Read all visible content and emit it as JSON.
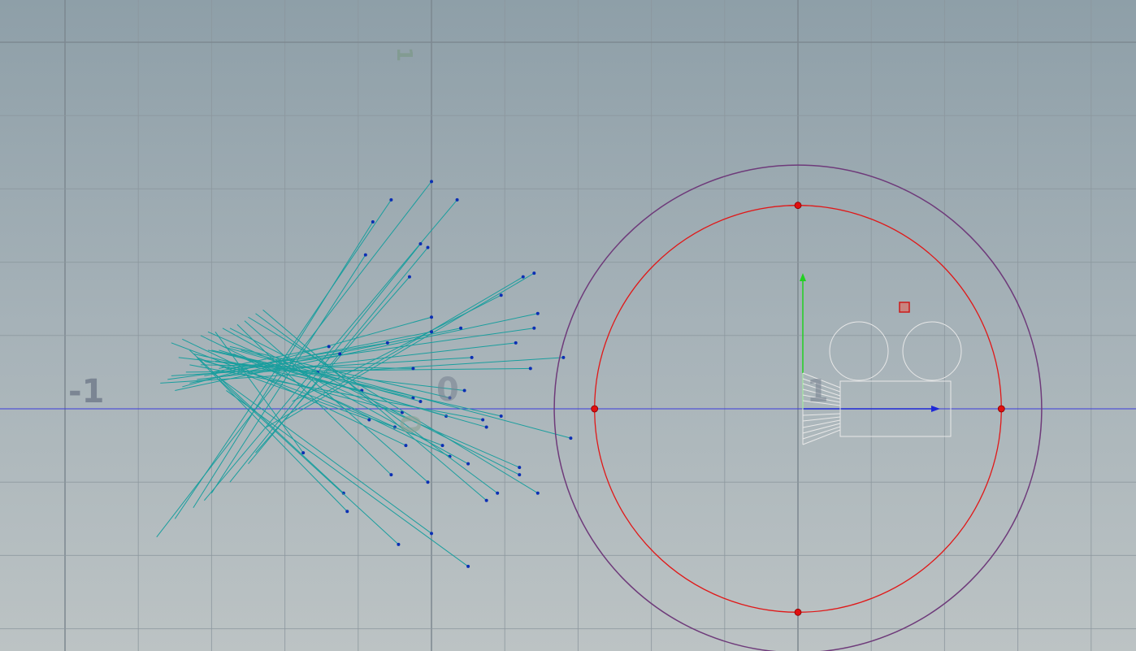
{
  "viewport": {
    "axis_labels": {
      "x_negative": "-1",
      "x_origin": "0",
      "x_positive": "1",
      "y_positive": "1",
      "y_origin": "0"
    },
    "colors": {
      "background_top": "#8e9fa8",
      "background_bottom": "#bcc3c4",
      "grid_minor": "#8c979e",
      "grid_major": "#7d8890",
      "x_axis": "#3b3bdc",
      "y_axis_gizmo": "#22d022",
      "x_gizmo": "#1e28d8",
      "stream_line": "#1a9e9e",
      "stream_point": "#0b2fb4",
      "inner_circle": "#e01818",
      "outer_circle": "#6e3a7a",
      "handle": "#e01010",
      "camera_wireframe": "#e8e8e8"
    },
    "icons": [
      "camera-icon",
      "pivot-handle-icon"
    ]
  },
  "scene": {
    "stream_lines": [
      {
        "from": [
          -0.75,
          -0.35
        ],
        "to": [
          0.0,
          0.62
        ]
      },
      {
        "from": [
          -0.7,
          -0.3
        ],
        "to": [
          -0.11,
          0.57
        ]
      },
      {
        "from": [
          -0.62,
          -0.25
        ],
        "to": [
          0.07,
          0.57
        ]
      },
      {
        "from": [
          -0.65,
          -0.27
        ],
        "to": [
          -0.16,
          0.51
        ]
      },
      {
        "from": [
          -0.55,
          -0.2
        ],
        "to": [
          -0.03,
          0.45
        ]
      },
      {
        "from": [
          -0.6,
          -0.23
        ],
        "to": [
          -0.18,
          0.42
        ]
      },
      {
        "from": [
          -0.5,
          -0.15
        ],
        "to": [
          -0.01,
          0.44
        ]
      },
      {
        "from": [
          -0.48,
          -0.12
        ],
        "to": [
          -0.06,
          0.36
        ]
      },
      {
        "from": [
          -0.45,
          -0.05
        ],
        "to": [
          0.25,
          0.36
        ]
      },
      {
        "from": [
          -0.4,
          -0.03
        ],
        "to": [
          0.28,
          0.37
        ]
      },
      {
        "from": [
          -0.38,
          0.02
        ],
        "to": [
          0.19,
          0.31
        ]
      },
      {
        "from": [
          -0.7,
          0.05
        ],
        "to": [
          0.29,
          0.26
        ]
      },
      {
        "from": [
          -0.72,
          0.08
        ],
        "to": [
          0.28,
          0.22
        ]
      },
      {
        "from": [
          -0.68,
          0.06
        ],
        "to": [
          0.0,
          0.25
        ]
      },
      {
        "from": [
          -0.66,
          0.07
        ],
        "to": [
          0.08,
          0.22
        ]
      },
      {
        "from": [
          -0.64,
          0.08
        ],
        "to": [
          0.23,
          0.18
        ]
      },
      {
        "from": [
          -0.62,
          0.09
        ],
        "to": [
          0.0,
          0.21
        ]
      },
      {
        "from": [
          -0.6,
          0.1
        ],
        "to": [
          -0.12,
          0.18
        ]
      },
      {
        "from": [
          -0.58,
          0.11
        ],
        "to": [
          -0.28,
          0.17
        ]
      },
      {
        "from": [
          -0.56,
          0.11
        ],
        "to": [
          -0.25,
          0.15
        ]
      },
      {
        "from": [
          -0.74,
          0.07
        ],
        "to": [
          0.36,
          0.14
        ]
      },
      {
        "from": [
          -0.71,
          0.09
        ],
        "to": [
          0.11,
          0.14
        ]
      },
      {
        "from": [
          -0.67,
          0.1
        ],
        "to": [
          0.27,
          0.11
        ]
      },
      {
        "from": [
          -0.63,
          0.12
        ],
        "to": [
          -0.05,
          0.11
        ]
      },
      {
        "from": [
          -0.59,
          0.13
        ],
        "to": [
          -0.31,
          0.1
        ]
      },
      {
        "from": [
          -0.69,
          0.14
        ],
        "to": [
          0.09,
          0.05
        ]
      },
      {
        "from": [
          -0.65,
          0.15
        ],
        "to": [
          -0.19,
          0.05
        ]
      },
      {
        "from": [
          -0.61,
          0.16
        ],
        "to": [
          -0.05,
          0.03
        ]
      },
      {
        "from": [
          -0.57,
          0.17
        ],
        "to": [
          -0.03,
          0.02
        ]
      },
      {
        "from": [
          -0.55,
          0.17
        ],
        "to": [
          0.05,
          0.03
        ]
      },
      {
        "from": [
          -0.6,
          0.16
        ],
        "to": [
          0.19,
          -0.02
        ]
      },
      {
        "from": [
          -0.58,
          0.16
        ],
        "to": [
          0.04,
          -0.02
        ]
      },
      {
        "from": [
          -0.62,
          0.13
        ],
        "to": [
          -0.08,
          -0.01
        ]
      },
      {
        "from": [
          -0.66,
          0.12
        ],
        "to": [
          0.14,
          -0.03
        ]
      },
      {
        "from": [
          -0.64,
          0.14
        ],
        "to": [
          -0.17,
          -0.03
        ]
      },
      {
        "from": [
          -0.56,
          0.15
        ],
        "to": [
          0.15,
          -0.05
        ]
      },
      {
        "from": [
          -0.54,
          0.15
        ],
        "to": [
          -0.1,
          -0.05
        ]
      },
      {
        "from": [
          -0.52,
          0.16
        ],
        "to": [
          0.38,
          -0.08
        ]
      },
      {
        "from": [
          -0.71,
          0.18
        ],
        "to": [
          0.03,
          -0.1
        ]
      },
      {
        "from": [
          -0.68,
          0.19
        ],
        "to": [
          -0.07,
          -0.1
        ]
      },
      {
        "from": [
          -0.63,
          0.2
        ],
        "to": [
          0.05,
          -0.13
        ]
      },
      {
        "from": [
          -0.61,
          0.21
        ],
        "to": [
          0.24,
          -0.16
        ]
      },
      {
        "from": [
          -0.59,
          0.21
        ],
        "to": [
          -0.35,
          -0.12
        ]
      },
      {
        "from": [
          -0.57,
          0.22
        ],
        "to": [
          0.1,
          -0.15
        ]
      },
      {
        "from": [
          -0.55,
          0.22
        ],
        "to": [
          0.24,
          -0.18
        ]
      },
      {
        "from": [
          -0.53,
          0.23
        ],
        "to": [
          -0.11,
          -0.18
        ]
      },
      {
        "from": [
          -0.51,
          0.24
        ],
        "to": [
          -0.01,
          -0.2
        ]
      },
      {
        "from": [
          -0.5,
          0.25
        ],
        "to": [
          0.29,
          -0.23
        ]
      },
      {
        "from": [
          -0.48,
          0.26
        ],
        "to": [
          0.18,
          -0.23
        ]
      },
      {
        "from": [
          -0.46,
          0.27
        ],
        "to": [
          0.15,
          -0.25
        ]
      },
      {
        "from": [
          -0.66,
          0.16
        ],
        "to": [
          -0.24,
          -0.23
        ]
      },
      {
        "from": [
          -0.64,
          0.14
        ],
        "to": [
          -0.23,
          -0.28
        ]
      },
      {
        "from": [
          -0.6,
          0.1
        ],
        "to": [
          0.0,
          -0.34
        ]
      },
      {
        "from": [
          -0.58,
          0.08
        ],
        "to": [
          -0.09,
          -0.37
        ]
      },
      {
        "from": [
          -0.56,
          0.05
        ],
        "to": [
          0.1,
          -0.43
        ]
      }
    ],
    "inner_circle": {
      "center": [
        1.0,
        0.0
      ],
      "radius": 0.555
    },
    "outer_circle": {
      "center": [
        1.0,
        0.0
      ],
      "radius": 0.665
    },
    "handles": [
      [
        1.0,
        0.555
      ],
      [
        1.0,
        -0.555
      ],
      [
        0.445,
        0.0
      ],
      [
        1.555,
        0.0
      ]
    ],
    "camera": {
      "origin": [
        1.0,
        0.0
      ]
    }
  }
}
